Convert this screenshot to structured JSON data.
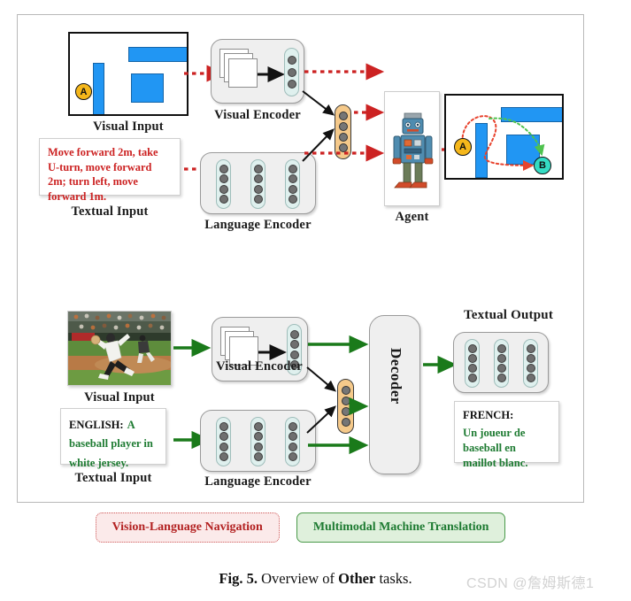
{
  "figure": {
    "caption_prefix": "Fig. 5.",
    "caption_mid": "Overview of",
    "caption_bold": "Other",
    "caption_suffix": "tasks.",
    "watermark": "CSDN @詹姆斯德1"
  },
  "colors": {
    "vln_accent": "#cc2222",
    "mmt_accent": "#1e7b32",
    "map_block": "#2196f3",
    "node_a": "#f5b71b",
    "node_b": "#34dcc4",
    "fusion_vector": "#f5c98a",
    "token_column": "#dff0ee",
    "encoder_body": "#efefef",
    "frame_border": "#b9b9b9"
  },
  "vln": {
    "visual_input_label": "Visual Input",
    "textual_input_label": "Textual Input",
    "visual_encoder_label": "Visual Encoder",
    "language_encoder_label": "Language Encoder",
    "agent_label": "Agent",
    "instruction_text": "Move forward 2m, take U-turn, move forward 2m; turn left, move forward 1m.",
    "start_node": "A",
    "goal_node": "B",
    "visual_encoder_dots": 3,
    "language_encoder_columns": 3,
    "language_encoder_dots_per_column": 4,
    "fusion_vector_dots": 4
  },
  "mmt": {
    "visual_input_label": "Visual Input",
    "textual_input_label": "Textual Input",
    "visual_encoder_label": "Visual Encoder",
    "language_encoder_label": "Language Encoder",
    "decoder_label": "Decoder",
    "textual_output_label": "Textual Output",
    "source_lang_label": "ENGLISH:",
    "source_text": "A baseball player in white jersey.",
    "target_lang_label": "FRENCH:",
    "target_text": "Un joueur de baseball en maillot blanc.",
    "visual_encoder_dots": 4,
    "language_encoder_columns": 3,
    "language_encoder_dots_per_column": 4,
    "fusion_vector_dots": 4,
    "output_columns": 3,
    "output_dots_per_column": 4
  },
  "legend": {
    "vln_pill": "Vision-Language Navigation",
    "mmt_pill": "Multimodal Machine Translation"
  }
}
